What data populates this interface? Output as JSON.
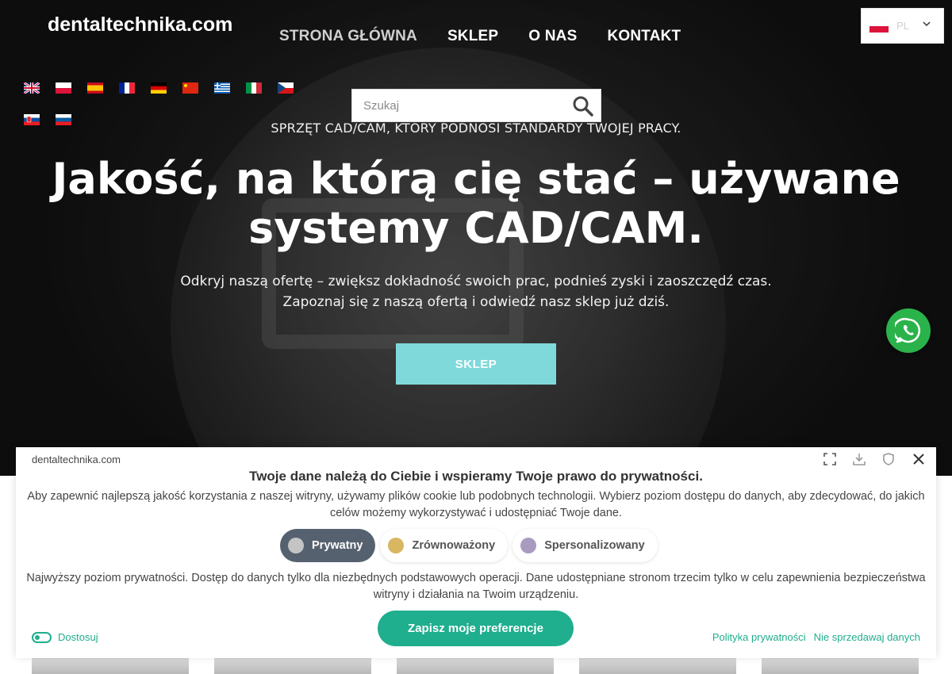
{
  "header": {
    "logo": "dentaltechnika.com",
    "nav": [
      {
        "label": "STRONA GŁÓWNA",
        "active": true
      },
      {
        "label": "SKLEP",
        "active": false
      },
      {
        "label": "O NAS",
        "active": false
      },
      {
        "label": "KONTAKT",
        "active": false
      }
    ],
    "language_select": {
      "value": "PL",
      "icon": "poland-flag-icon"
    }
  },
  "flags": [
    "uk",
    "poland",
    "spain",
    "france",
    "germany",
    "china",
    "greece",
    "italy",
    "czech",
    "slovakia",
    "slovenia"
  ],
  "search": {
    "placeholder": "Szukaj",
    "icon": "search-icon"
  },
  "hero": {
    "tagline": "SPRZĘT CAD/CAM, KTÓRY PODNOSI STANDARDY TWOJEJ PRACY.",
    "headline": "Jakość, na którą cię stać – używane systemy CAD/CAM.",
    "subline_1": "Odkryj naszą ofertę – zwiększ dokładność swoich prac, podnieś zyski i zaoszczędź czas.",
    "subline_2": "Zapoznaj się z naszą ofertą i odwiedź nasz sklep już dziś.",
    "button": "SKLEP"
  },
  "whatsapp": {
    "icon": "whatsapp-icon"
  },
  "cookie_banner": {
    "site": "dentaltechnika.com",
    "title": "Twoje dane należą do Ciebie i wspieramy Twoje prawo do prywatności.",
    "description": "Aby zapewnić najlepszą jakość korzystania z naszej witryny, używamy plików cookie lub podobnych technologii. Wybierz poziom dostępu do danych, aby zdecydować, do jakich celów możemy wykorzystywać i udostępniać Twoje dane.",
    "levels": [
      {
        "label": "Prywatny",
        "selected": true,
        "color": "#c4c4c4"
      },
      {
        "label": "Zrównoważony",
        "selected": false,
        "color": "#d9b661"
      },
      {
        "label": "Spersonalizowany",
        "selected": false,
        "color": "#a99bc0"
      }
    ],
    "level_description": "Najwyższy poziom prywatności. Dostęp do danych tylko dla niezbędnych podstawowych operacji. Dane udostępniane stronom trzecim tylko w celu zapewnienia bezpieczeństwa witryny i działania na Twoim urządzeniu.",
    "customize": "Dostosuj",
    "save": "Zapisz moje preferencje",
    "privacy_policy": "Polityka prywatności",
    "do_not_sell": "Nie sprzedawaj danych"
  },
  "colors": {
    "accent": "#1fae8e",
    "hero_button": "#7fd9db",
    "whatsapp": "#2bb34b",
    "selected_level": "#566170"
  }
}
